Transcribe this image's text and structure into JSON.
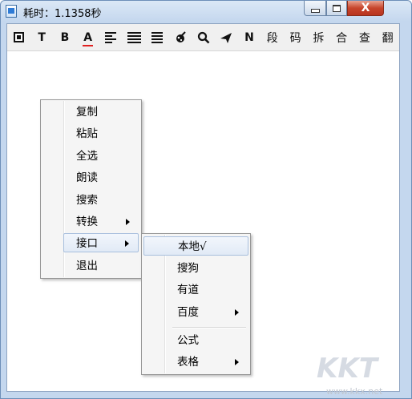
{
  "window": {
    "title": "耗时：1.1358秒",
    "controls": {
      "minimize": "",
      "maximize": "",
      "close": "X"
    }
  },
  "toolbar": {
    "buttons": [
      {
        "icon": "stop-square-icon",
        "label": ""
      },
      {
        "icon": "text-icon",
        "label": "T"
      },
      {
        "icon": "bold-icon",
        "label": "B"
      },
      {
        "icon": "font-color-icon",
        "label": "A"
      },
      {
        "icon": "align-left-icon",
        "label": ""
      },
      {
        "icon": "align-justify-icon",
        "label": ""
      },
      {
        "icon": "align-right-icon",
        "label": ""
      },
      {
        "icon": "brush-icon",
        "label": ""
      },
      {
        "icon": "search-icon",
        "label": ""
      },
      {
        "icon": "send-icon",
        "label": ""
      },
      {
        "icon": "n-icon",
        "label": "N"
      },
      {
        "icon": "",
        "label": "段"
      },
      {
        "icon": "",
        "label": "码"
      },
      {
        "icon": "",
        "label": "拆"
      },
      {
        "icon": "",
        "label": "合"
      },
      {
        "icon": "",
        "label": "查"
      },
      {
        "icon": "",
        "label": "翻"
      }
    ]
  },
  "context_menu": {
    "items": [
      {
        "label": "复制"
      },
      {
        "label": "粘贴"
      },
      {
        "label": "全选"
      },
      {
        "label": "朗读"
      },
      {
        "label": "搜索"
      },
      {
        "label": "转换",
        "submenu": true
      },
      {
        "label": "接口",
        "submenu": true,
        "highlighted": true
      },
      {
        "label": "退出"
      }
    ]
  },
  "submenu": {
    "items": [
      {
        "label": "本地√",
        "highlighted": true
      },
      {
        "label": "搜狗"
      },
      {
        "label": "有道"
      },
      {
        "label": "百度",
        "submenu": true
      },
      {
        "label": "公式"
      },
      {
        "label": "表格",
        "submenu": true
      }
    ]
  },
  "watermark": {
    "letters": "KKT",
    "url": "www.kkx.net"
  }
}
